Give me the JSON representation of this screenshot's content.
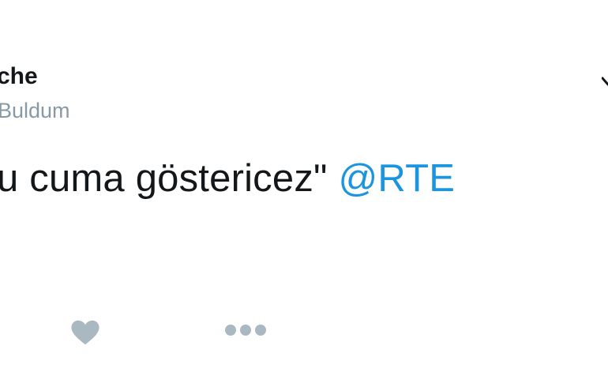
{
  "tweet": {
    "display_name": "che",
    "username": "Buldum",
    "text": "u cuma göstericez\" ",
    "mention": "@RTE"
  },
  "actions": {
    "like_icon": "heart-icon",
    "more_icon": "more-dots-icon",
    "caret_icon": "chevron-down-icon"
  },
  "colors": {
    "text": "#14171a",
    "secondary": "#8899a6",
    "mention": "#1b95e0",
    "action_icon": "#aab8c2"
  }
}
